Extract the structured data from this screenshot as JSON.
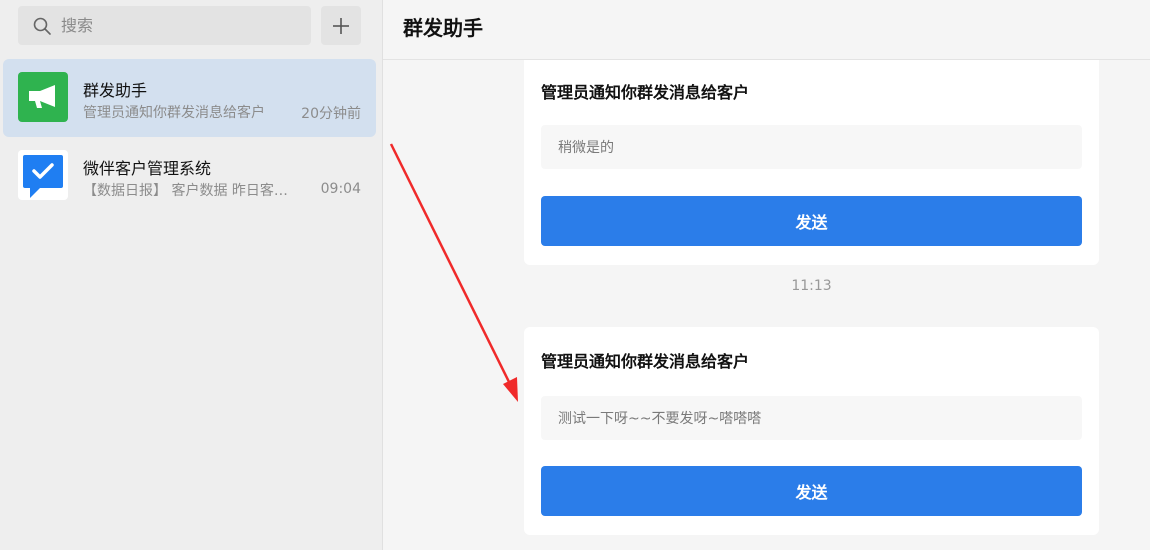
{
  "sidebar": {
    "search": {
      "placeholder": "搜索"
    },
    "add_icon": "plus-icon",
    "conversations": [
      {
        "name": "群发助手",
        "preview": "管理员通知你群发消息给客户",
        "time": "20分钟前",
        "active": true,
        "icon": "megaphone-icon",
        "color": "#2fb34f"
      },
      {
        "name": "微伴客户管理系统",
        "preview": "【数据日报】 客户数据 昨日客户...",
        "time": "09:04",
        "active": false,
        "icon": "checkmark-chat-icon",
        "color": "#1f7ef2"
      }
    ]
  },
  "main": {
    "title": "群发助手",
    "timestamp": "11:13",
    "messages": [
      {
        "title": "管理员通知你群发消息给客户",
        "content": "稍微是的",
        "button": "发送"
      },
      {
        "title": "管理员通知你群发消息给客户",
        "content": "测试一下呀~~不要发呀~嗒嗒嗒",
        "button": "发送"
      }
    ]
  },
  "colors": {
    "accent": "#2b7de9",
    "annotation_arrow": "#f02a2a",
    "active_row": "#d3e0ef"
  }
}
